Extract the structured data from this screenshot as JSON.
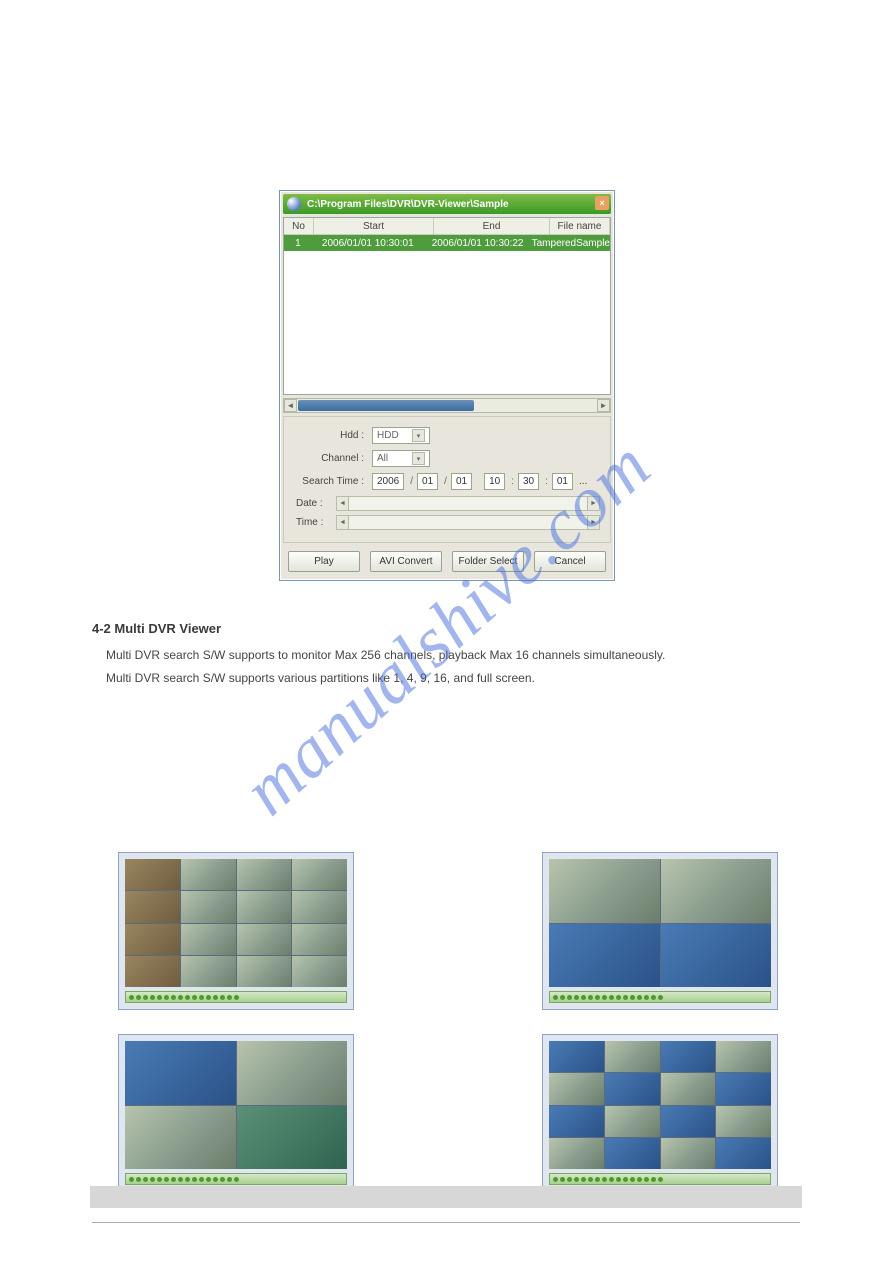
{
  "intro_text": "",
  "dialog": {
    "title": "C:\\Program Files\\DVR\\DVR-Viewer\\Sample",
    "columns": {
      "no": "No",
      "start": "Start",
      "end": "End",
      "file": "File name"
    },
    "row": {
      "no": "1",
      "start": "2006/01/01  10:30:01",
      "end": "2006/01/01  10:30:22",
      "file": "TamperedSample"
    },
    "labels": {
      "hdd": "Hdd :",
      "channel": "Channel :",
      "search": "Search Time :",
      "date": "Date :",
      "time": "Time :"
    },
    "hdd_value": "HDD",
    "channel_value": "All",
    "search_time": {
      "y": "2006",
      "mo": "01",
      "d": "01",
      "h": "10",
      "mi": "30",
      "s": "01",
      "slash": "/",
      "colon": ":"
    },
    "dots": "...",
    "buttons": {
      "play": "Play",
      "avi": "AVI Convert",
      "folder": "Folder Select",
      "cancel": "Cancel"
    }
  },
  "section": {
    "heading": "4-2 Multi DVR Viewer",
    "p1": "Multi DVR search S/W supports to monitor Max 256 channels, playback Max 16 channels simultaneously.",
    "p2": "Multi DVR search S/W supports various partitions like 1, 4, 9, 16, and full screen."
  },
  "watermark": "manualshive.com"
}
